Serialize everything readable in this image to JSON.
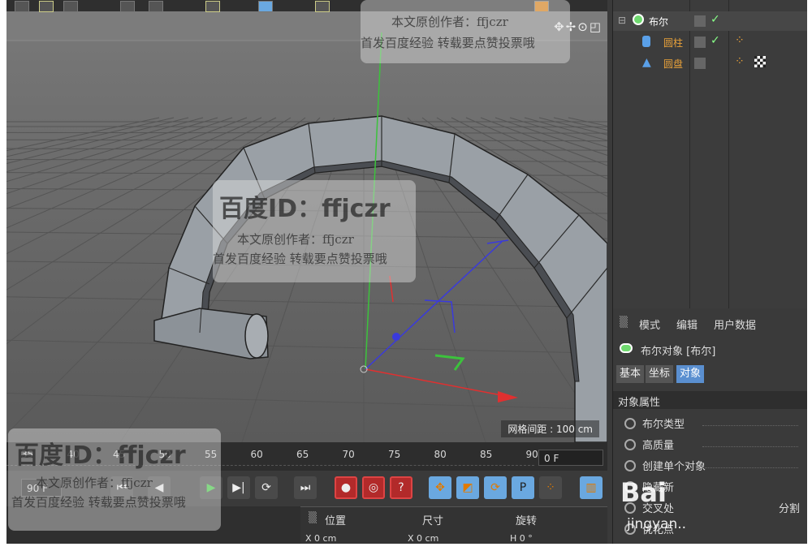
{
  "viewport": {
    "grid_spacing_label": "网格间距 : 100 cm",
    "nav_icons": "✥✢⊙◰"
  },
  "timeline": {
    "ticks": [
      "35",
      "40",
      "45",
      "50",
      "55",
      "60",
      "65",
      "70",
      "75",
      "80",
      "85",
      "90"
    ],
    "current_frame": "0 F",
    "start_frame": "90 F"
  },
  "transport": {
    "buttons": [
      "go-start",
      "prev-key",
      "prev-frame",
      "play",
      "next-frame",
      "loop",
      "go-end",
      "record",
      "autokey",
      "keyframe-help",
      "move",
      "scale",
      "rotate",
      "param",
      "points",
      "film"
    ]
  },
  "coordinates": {
    "position": "位置",
    "size": "尺寸",
    "rotation": "旋转",
    "x_pos": "0 cm",
    "x_size": "0 cm",
    "h_rot": "0 °"
  },
  "object_manager": {
    "objects": [
      {
        "name": "布尔",
        "color": "#ffffff",
        "icon": "boole-icon"
      },
      {
        "name": "圆柱",
        "color": "#e8a13a",
        "icon": "cylinder-icon"
      },
      {
        "name": "圆盘",
        "color": "#e8a13a",
        "icon": "disc-icon"
      }
    ]
  },
  "attributes": {
    "menu": [
      "模式",
      "编辑",
      "用户数据"
    ],
    "object_title": "布尔对象 [布尔]",
    "tabs": [
      "基本",
      "坐标",
      "对象"
    ],
    "section": "对象属性",
    "properties": [
      "布尔类型",
      "高质量",
      "创建单个对象",
      "隐藏新的边",
      "交叉处创建平滑着色(Phong)分割",
      "优化点"
    ],
    "props_visible": [
      "布尔类型",
      "高质量",
      "创建单个对象",
      "隐藏新",
      "交叉处",
      "优化点"
    ],
    "split_text": "分割"
  },
  "watermarks": {
    "id_text": "百度ID：ffjczr",
    "author": "本文原创作者：ffjczr",
    "note": "首发百度经验 转载要点赞投票哦",
    "logo": "Bai",
    "logo_sub": "jingyan.."
  }
}
